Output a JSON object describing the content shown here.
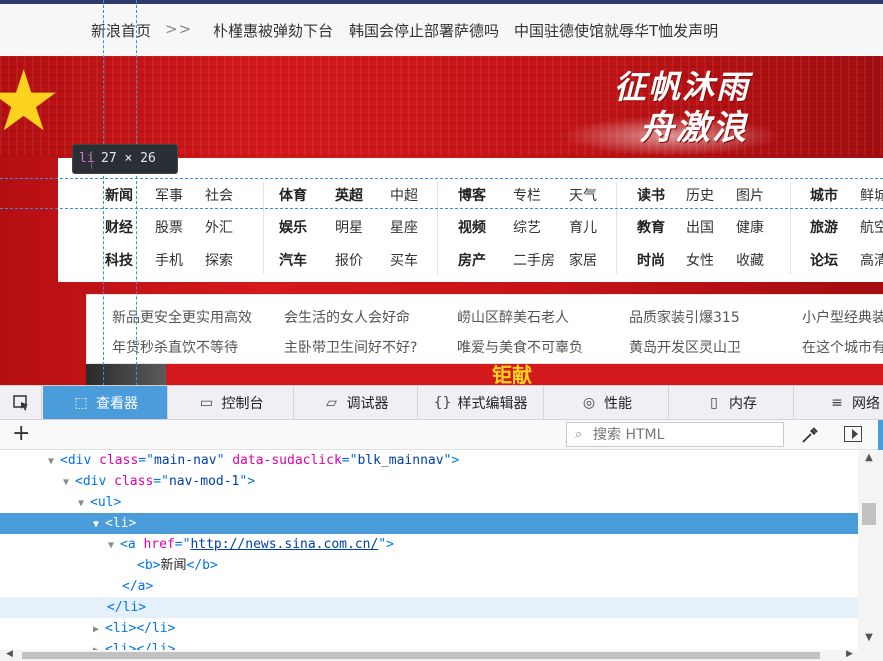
{
  "topbar": {
    "home": "新浪首页",
    "arrow": ">>",
    "headlines": [
      "朴槿惠被弹劾下台",
      "韩国会停止部署萨德吗",
      "中国驻德使馆就辱华T恤发声明"
    ]
  },
  "banner": {
    "slogan_line1": "征帆沐雨",
    "slogan_line2": "舟激浪",
    "star_icon": "star-icon"
  },
  "main_nav": {
    "rows": [
      [
        "新闻",
        "军事",
        "社会",
        "体育",
        "英超",
        "中超",
        "博客",
        "专栏",
        "天气",
        "读书",
        "历史",
        "图片",
        "城市",
        "鲜城"
      ],
      [
        "财经",
        "股票",
        "外汇",
        "娱乐",
        "明星",
        "星座",
        "视频",
        "综艺",
        "育儿",
        "教育",
        "出国",
        "健康",
        "旅游",
        "航空"
      ],
      [
        "科技",
        "手机",
        "探索",
        "汽车",
        "报价",
        "买车",
        "房产",
        "二手房",
        "家居",
        "时尚",
        "女性",
        "收藏",
        "论坛",
        "高清"
      ]
    ]
  },
  "news_links": {
    "row1": [
      "新品更安全更实用高效",
      "会生活的女人会好命",
      "崂山区醉美石老人",
      "品质家装引爆315",
      "小户型经典装"
    ],
    "row2": [
      "年货秒杀直饮不等待",
      "主卧带卫生间好不好?",
      "唯爱与美食不可辜负",
      "黄岛开发区灵山卫",
      "在这个城市有"
    ]
  },
  "ad": {
    "text": "钜献"
  },
  "inspector_tooltip": {
    "tag": "li",
    "size": "27 × 26"
  },
  "devtools": {
    "tabs": [
      {
        "label": "查看器",
        "icon": "inspector-icon"
      },
      {
        "label": "控制台",
        "icon": "console-icon"
      },
      {
        "label": "调试器",
        "icon": "debugger-icon"
      },
      {
        "label": "样式编辑器",
        "icon": "style-editor-icon"
      },
      {
        "label": "性能",
        "icon": "performance-icon"
      },
      {
        "label": "内存",
        "icon": "memory-icon"
      },
      {
        "label": "网络",
        "icon": "network-icon"
      }
    ],
    "active_tab": "查看器",
    "search_placeholder": "搜索 HTML",
    "accent_color": "#4a9cdb",
    "tree": {
      "r0": {
        "tag": "div",
        "attr1": "class",
        "val1": "main-nav",
        "attr2": "data-sudaclick",
        "val2": "blk_mainnav"
      },
      "r1": {
        "tag": "div",
        "attr1": "class",
        "val1": "nav-mod-1"
      },
      "r2": {
        "tag": "ul"
      },
      "r3": {
        "tag": "li"
      },
      "r4": {
        "tag": "a",
        "attr1": "href",
        "val1": "http://news.sina.com.cn/"
      },
      "r5": {
        "open": "<b>",
        "text": "新闻",
        "close": "</b>"
      },
      "r6": {
        "close": "</a>"
      },
      "r7": {
        "close": "</li>"
      },
      "r8": {
        "open": "<li>",
        "close": "</li>"
      },
      "r9": {
        "open": "<li>",
        "close": "</li>"
      }
    }
  }
}
